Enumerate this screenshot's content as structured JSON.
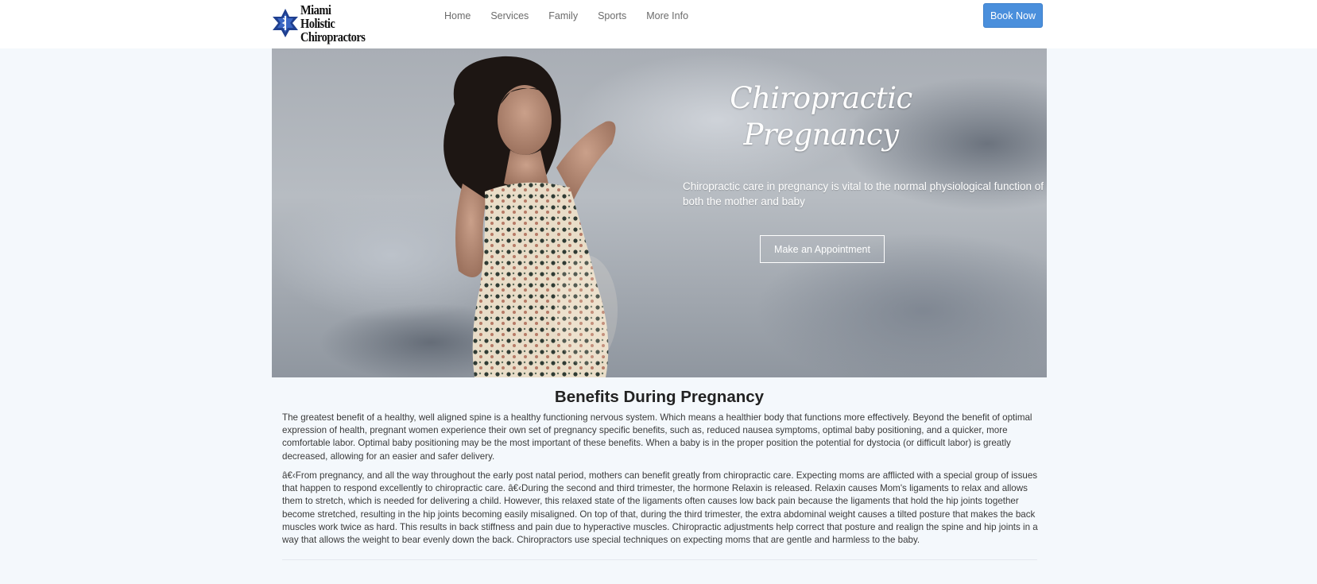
{
  "header": {
    "logo_line1": "Miami Holistic",
    "logo_line2": "Chiropractors",
    "nav": [
      "Home",
      "Services",
      "Family",
      "Sports",
      "More Info"
    ],
    "book_label": "Book Now"
  },
  "hero": {
    "title_line1": "Chiropractic",
    "title_line2": "Pregnancy",
    "subtitle": "Chiropractic care in pregnancy is vital to the normal physiological function of both the mother and baby",
    "button_label": "Make an Appointment"
  },
  "content": {
    "heading": "Benefits During Pregnancy",
    "paragraph1": "The greatest benefit of a healthy, well aligned spine is a healthy functioning nervous system. Which means a healthier body that functions more effectively. Beyond the benefit of optimal expression of health, pregnant women experience their own set of pregnancy specific benefits, such as, reduced nausea symptoms, optimal baby positioning, and a quicker, more comfortable labor. Optimal baby positioning may be the most important of these benefits. When a baby is in the proper position the potential for dystocia (or difficult labor) is greatly decreased, allowing for an easier and safer delivery.",
    "paragraph2": "â€‹From pregnancy, and all the way throughout the early post natal period, mothers can benefit greatly from chiropractic care. Expecting moms are afflicted with a special group of issues that happen to respond excellently to chiropractic care. â€‹During the second and third trimester, the hormone Relaxin is released. Relaxin causes Mom's ligaments to relax and allows them to stretch, which is needed for delivering a child. However, this relaxed state of the ligaments often causes low back pain because the ligaments that hold the hip joints together become stretched, resulting in the hip joints becoming easily misaligned. On top of that, during the third trimester, the extra abdominal weight causes a tilted posture that makes the back muscles work twice as hard. This results in back stiffness and pain due to hyperactive muscles. Chiropractic adjustments help correct that posture and realign the spine and hip joints in a way that allows the weight to bear evenly down the back. Chiropractors use special techniques on expecting moms that are gentle and harmless to the baby."
  },
  "colors": {
    "accent": "#4a8fdc",
    "page_bg": "#f4f8fc",
    "logo_blue": "#1f3f8f"
  },
  "icons": {
    "logo": "star-of-life-icon"
  }
}
